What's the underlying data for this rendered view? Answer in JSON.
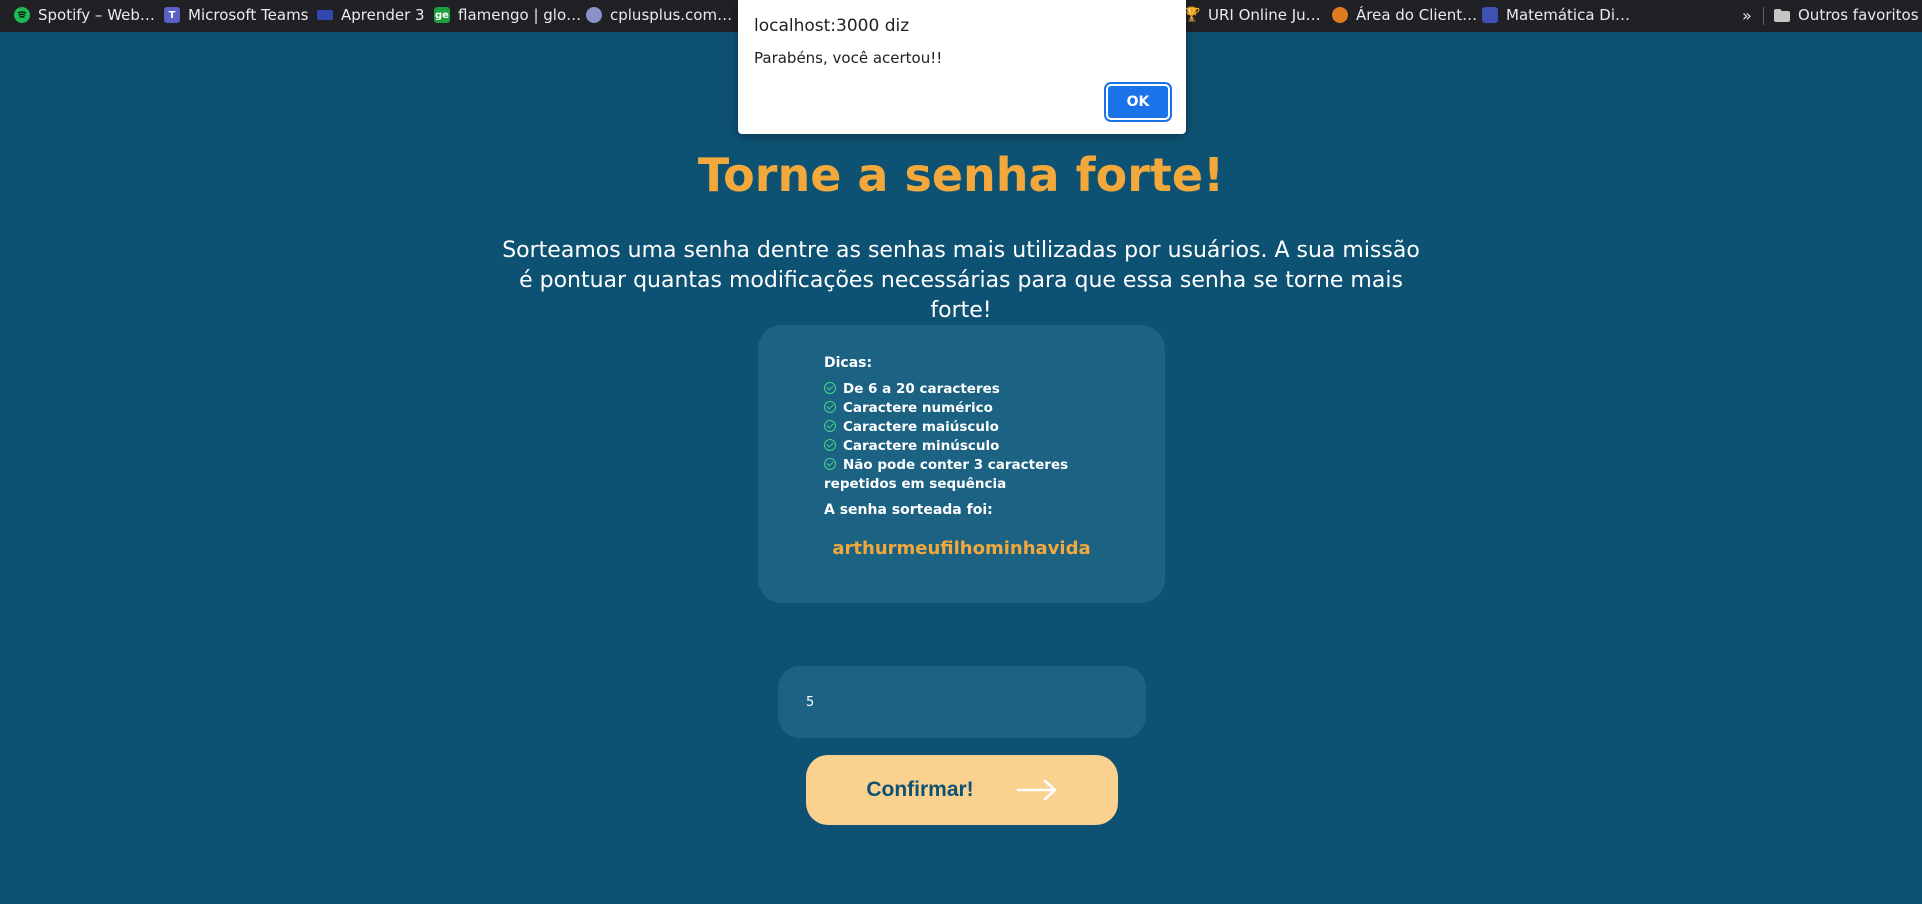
{
  "bookmarks": {
    "items": [
      {
        "label": "Spotify – Web…",
        "icon": "spotify-icon",
        "color": "#1db954"
      },
      {
        "label": "Microsoft Teams",
        "icon": "teams-icon",
        "color": "#5b5fc7"
      },
      {
        "label": "Aprender 3",
        "icon": "aprender-icon",
        "color": "#3347b0"
      },
      {
        "label": "flamengo | glo…",
        "icon": "ge-icon",
        "color": "#1e9e3e"
      },
      {
        "label": "cplusplus.com…",
        "icon": "cplusplus-icon",
        "color": "#8a90c8"
      },
      {
        "label": "URI Online Ju…",
        "icon": "trophy-icon",
        "color": "#e2a21a"
      },
      {
        "label": "Área do Client…",
        "icon": "client-area-icon",
        "color": "#e07b22"
      },
      {
        "label": "Matemática Di…",
        "icon": "math-icon",
        "color": "#3f51b5"
      }
    ],
    "more": "»",
    "other_favorites": "Outros favoritos"
  },
  "dialog": {
    "origin": "localhost:3000 diz",
    "message": "Parabéns, você acertou!!",
    "ok_label": "OK"
  },
  "main": {
    "title": "Torne a senha forte!",
    "subtitle": "Sorteamos uma senha dentre as senhas mais utilizadas por usuários. A sua missão é pontuar quantas modificações necessárias para que essa senha se torne mais forte!",
    "card": {
      "heading": "Dicas:",
      "tips": [
        "De 6 a 20 caracteres",
        "Caractere numérico",
        "Caractere maiúsculo",
        "Caractere minúsculo",
        "Não pode conter 3 caracteres repetidos em sequência"
      ],
      "drawn_label": "A senha sorteada foi:",
      "drawn_password": "arthurmeufilhominhavida"
    },
    "answer_value": "5",
    "confirm_label": "Confirmar!"
  },
  "colors": {
    "background": "#0e5273",
    "card": "#1b6283",
    "accent": "#f3a83c",
    "button": "#fbd18f",
    "check": "#48d38a"
  }
}
